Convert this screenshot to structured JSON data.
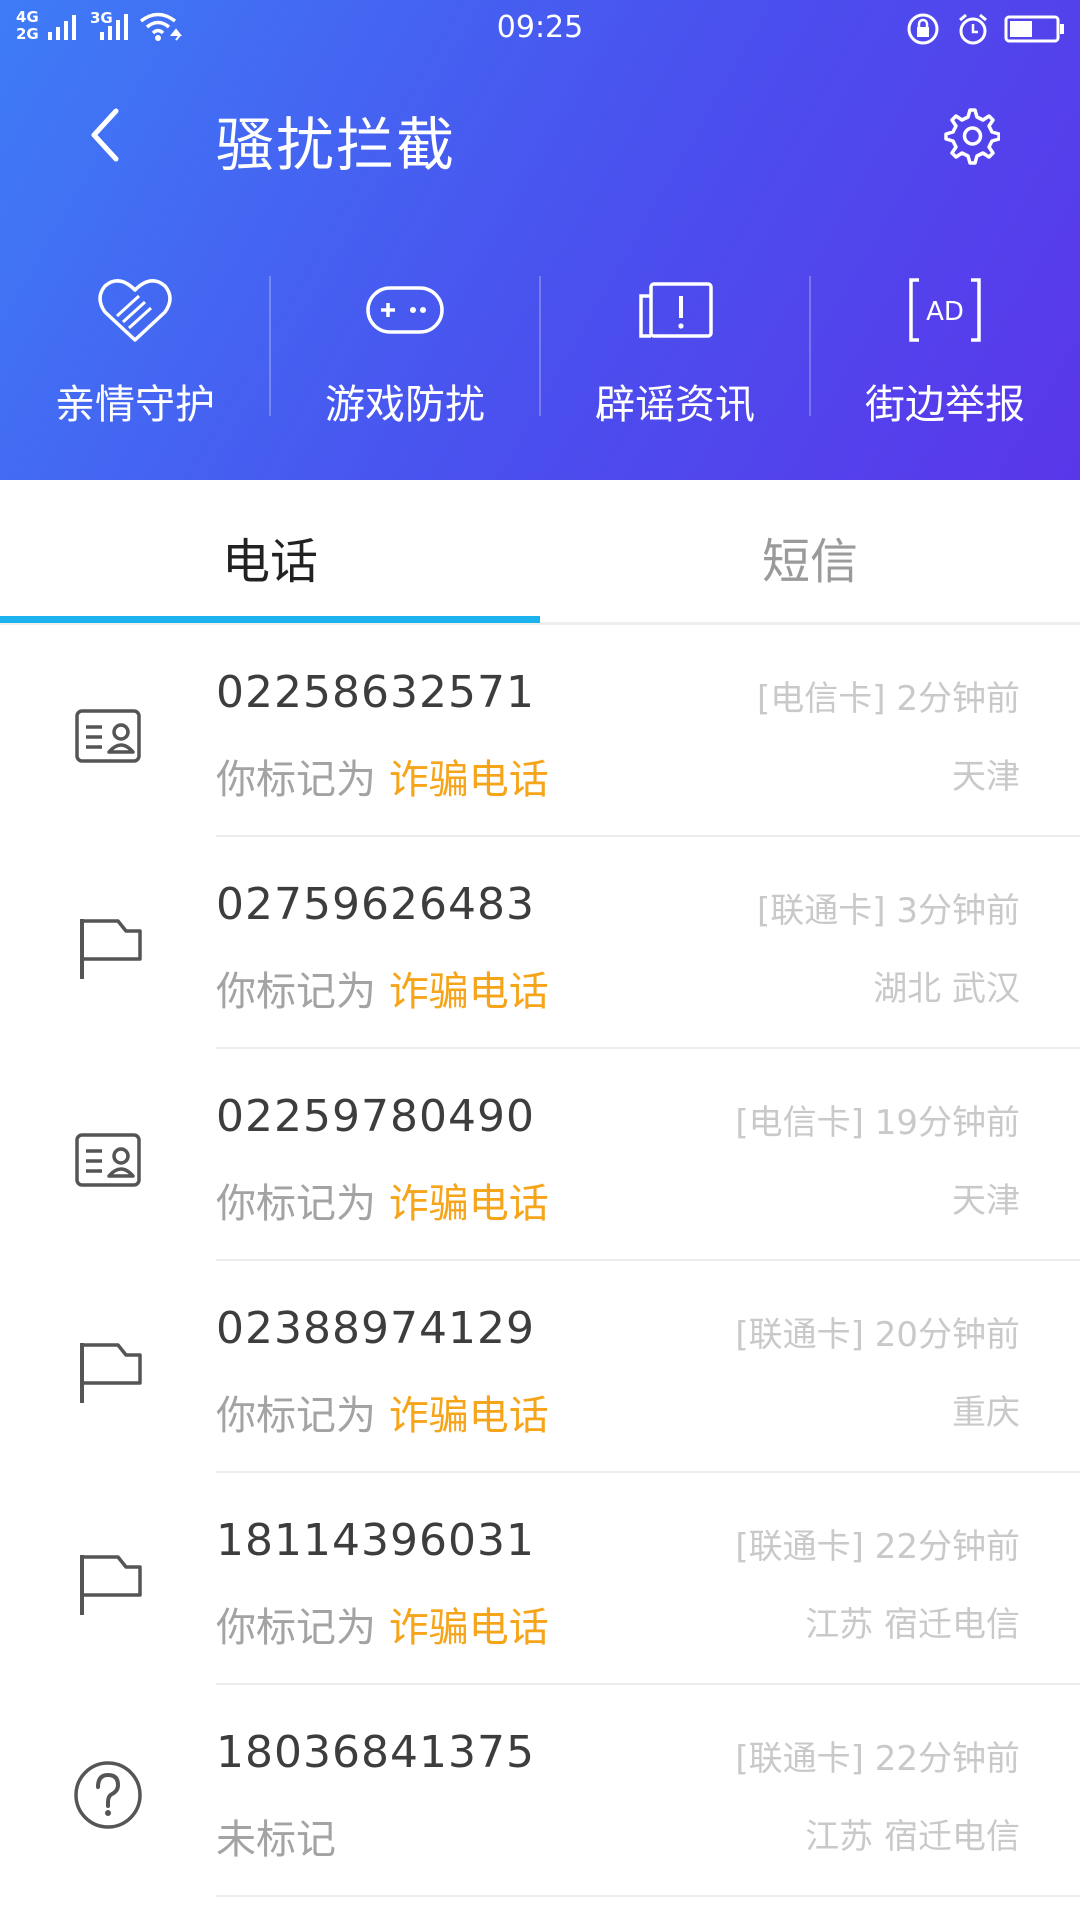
{
  "status_bar": {
    "network_top": "4G",
    "network_bottom": "2G",
    "network_3g": "3G",
    "time": "09:25"
  },
  "header": {
    "title": "骚扰拦截"
  },
  "features": [
    {
      "label": "亲情守护",
      "icon": "heart-hands-icon"
    },
    {
      "label": "游戏防扰",
      "icon": "gamepad-icon"
    },
    {
      "label": "辟谣资讯",
      "icon": "rumor-notice-icon"
    },
    {
      "label": "街边举报",
      "icon": "ad-report-icon"
    }
  ],
  "tabs": [
    {
      "label": "电话",
      "active": true
    },
    {
      "label": "短信",
      "active": false
    }
  ],
  "colors": {
    "accent": "#1bb2ee",
    "tag": "#f6a419",
    "header_start": "#3e7cf6",
    "header_end": "#5a36ea"
  },
  "calls": [
    {
      "number": "02258632571",
      "meta": "[电信卡] 2分钟前",
      "mark_prefix": "你标记为 ",
      "mark_tag": "诈骗电话",
      "location": "天津",
      "icon": "contact-card-icon"
    },
    {
      "number": "02759626483",
      "meta": "[联通卡] 3分钟前",
      "mark_prefix": "你标记为 ",
      "mark_tag": "诈骗电话",
      "location": "湖北 武汉",
      "icon": "flag-icon"
    },
    {
      "number": "02259780490",
      "meta": "[电信卡] 19分钟前",
      "mark_prefix": "你标记为 ",
      "mark_tag": "诈骗电话",
      "location": "天津",
      "icon": "contact-card-icon"
    },
    {
      "number": "02388974129",
      "meta": "[联通卡] 20分钟前",
      "mark_prefix": "你标记为 ",
      "mark_tag": "诈骗电话",
      "location": "重庆",
      "icon": "flag-icon"
    },
    {
      "number": "18114396031",
      "meta": "[联通卡] 22分钟前",
      "mark_prefix": "你标记为 ",
      "mark_tag": "诈骗电话",
      "location": "江苏 宿迁电信",
      "icon": "flag-icon"
    },
    {
      "number": "18036841375",
      "meta": "[联通卡] 22分钟前",
      "mark_prefix": "未标记",
      "mark_tag": "",
      "location": "江苏 宿迁电信",
      "icon": "question-icon"
    }
  ]
}
